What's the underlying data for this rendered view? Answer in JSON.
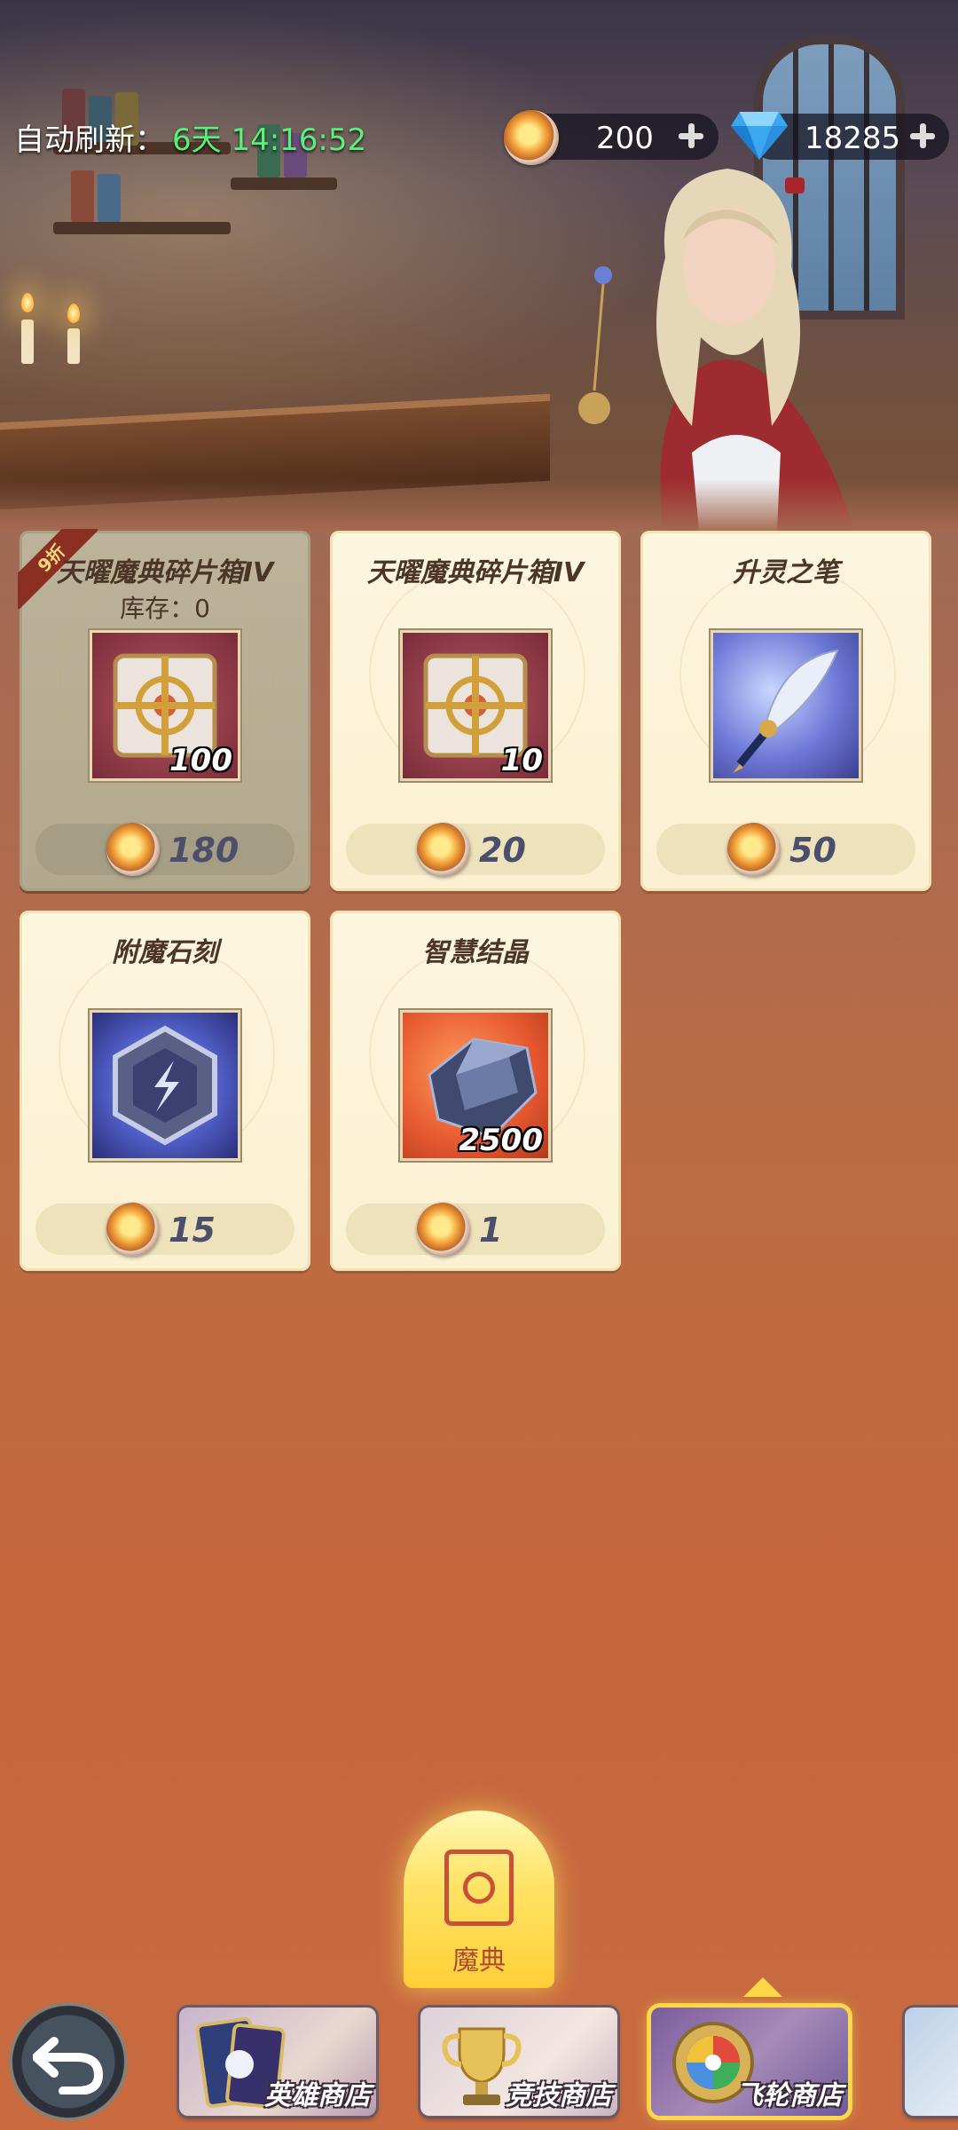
{
  "header": {
    "refresh_label": "自动刷新：",
    "refresh_time": "6天 14:16:52"
  },
  "currencies": [
    {
      "icon": "coin-icon",
      "value": "200"
    },
    {
      "icon": "diamond-icon",
      "value": "18285"
    }
  ],
  "shop_items": [
    {
      "title": "天曜魔典碎片箱IV",
      "stock": "库存：0",
      "qty": "100",
      "price": "180",
      "badge": "9折",
      "sold_out": true,
      "icon": "chest-icon"
    },
    {
      "title": "天曜魔典碎片箱IV",
      "qty": "10",
      "price": "20",
      "icon": "chest-icon"
    },
    {
      "title": "升灵之笔",
      "qty": "",
      "price": "50",
      "icon": "quill-icon"
    },
    {
      "title": "附魔石刻",
      "qty": "",
      "price": "15",
      "icon": "rune-stone-icon"
    },
    {
      "title": "智慧结晶",
      "qty": "2500",
      "price": "1",
      "icon": "crystal-icon"
    }
  ],
  "sub_tab": {
    "label": "魔典",
    "icon": "grimoire-icon"
  },
  "bottom_tabs": [
    {
      "label": "英雄商店",
      "icon": "hero-card-icon",
      "active": false
    },
    {
      "label": "竞技商店",
      "icon": "trophy-icon",
      "active": false
    },
    {
      "label": "飞轮商店",
      "icon": "flywheel-icon",
      "active": true
    }
  ],
  "colors": {
    "timer": "#59f07a",
    "price_text": "#4c4f6c",
    "active_tab": "#ffd84a"
  }
}
